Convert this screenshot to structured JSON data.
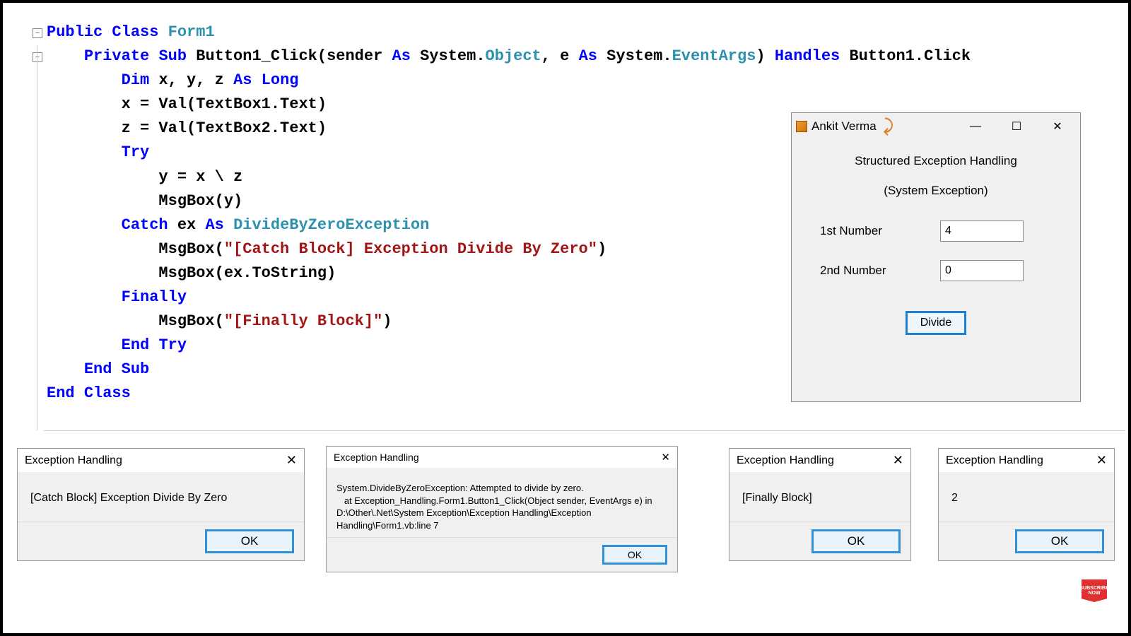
{
  "code": {
    "lines": [
      [
        {
          "t": "Public ",
          "c": "kw"
        },
        {
          "t": "Class ",
          "c": "kw"
        },
        {
          "t": "Form1",
          "c": "type"
        }
      ],
      [
        {
          "t": "    ",
          "c": ""
        },
        {
          "t": "Private ",
          "c": "kw"
        },
        {
          "t": "Sub ",
          "c": "kw"
        },
        {
          "t": "Button1_Click(sender ",
          "c": "id"
        },
        {
          "t": "As ",
          "c": "kw"
        },
        {
          "t": "System.",
          "c": "id"
        },
        {
          "t": "Object",
          "c": "type"
        },
        {
          "t": ", e ",
          "c": "id"
        },
        {
          "t": "As ",
          "c": "kw"
        },
        {
          "t": "System.",
          "c": "id"
        },
        {
          "t": "EventArgs",
          "c": "type"
        },
        {
          "t": ") ",
          "c": "id"
        },
        {
          "t": "Handles ",
          "c": "kw"
        },
        {
          "t": "Button1.Click",
          "c": "id"
        }
      ],
      [
        {
          "t": "        ",
          "c": ""
        },
        {
          "t": "Dim ",
          "c": "kw"
        },
        {
          "t": "x, y, z ",
          "c": "id"
        },
        {
          "t": "As ",
          "c": "kw"
        },
        {
          "t": "Long",
          "c": "kw"
        }
      ],
      [
        {
          "t": "        x = Val(TextBox1.Text)",
          "c": "id"
        }
      ],
      [
        {
          "t": "        z = Val(TextBox2.Text)",
          "c": "id"
        }
      ],
      [
        {
          "t": "        ",
          "c": ""
        },
        {
          "t": "Try",
          "c": "kw"
        }
      ],
      [
        {
          "t": "            y = x \\ z",
          "c": "id"
        }
      ],
      [
        {
          "t": "            MsgBox(y)",
          "c": "id"
        }
      ],
      [
        {
          "t": "        ",
          "c": ""
        },
        {
          "t": "Catch ",
          "c": "kw"
        },
        {
          "t": "ex ",
          "c": "id"
        },
        {
          "t": "As ",
          "c": "kw"
        },
        {
          "t": "DivideByZeroException",
          "c": "type"
        }
      ],
      [
        {
          "t": "            MsgBox(",
          "c": "id"
        },
        {
          "t": "\"[Catch Block] Exception Divide By Zero\"",
          "c": "str"
        },
        {
          "t": ")",
          "c": "id"
        }
      ],
      [
        {
          "t": "            MsgBox(ex.ToString)",
          "c": "id"
        }
      ],
      [
        {
          "t": "        ",
          "c": ""
        },
        {
          "t": "Finally",
          "c": "kw"
        }
      ],
      [
        {
          "t": "            MsgBox(",
          "c": "id"
        },
        {
          "t": "\"[Finally Block]\"",
          "c": "str"
        },
        {
          "t": ")",
          "c": "id"
        }
      ],
      [
        {
          "t": "        ",
          "c": ""
        },
        {
          "t": "End ",
          "c": "kw"
        },
        {
          "t": "Try",
          "c": "kw"
        }
      ],
      [
        {
          "t": "    ",
          "c": ""
        },
        {
          "t": "End ",
          "c": "kw"
        },
        {
          "t": "Sub",
          "c": "kw"
        }
      ],
      [
        {
          "t": "End ",
          "c": "kw"
        },
        {
          "t": "Class",
          "c": "kw"
        }
      ]
    ]
  },
  "app": {
    "title": "Ankit Verma",
    "header1": "Structured Exception Handling",
    "header2": "(System Exception)",
    "label1": "1st Number",
    "label2": "2nd Number",
    "value1": "4",
    "value2": "0",
    "button": "Divide"
  },
  "msg": {
    "title": "Exception Handling",
    "ok": "OK",
    "body1": "[Catch Block] Exception Divide By Zero",
    "body2": "System.DivideByZeroException: Attempted to divide by zero.\n   at Exception_Handling.Form1.Button1_Click(Object sender, EventArgs e) in D:\\Other\\.Net\\System Exception\\Exception Handling\\Exception Handling\\Form1.vb:line 7",
    "body3": "[Finally Block]",
    "body4": "2"
  },
  "badge": "SUBSCRIBE NOW"
}
